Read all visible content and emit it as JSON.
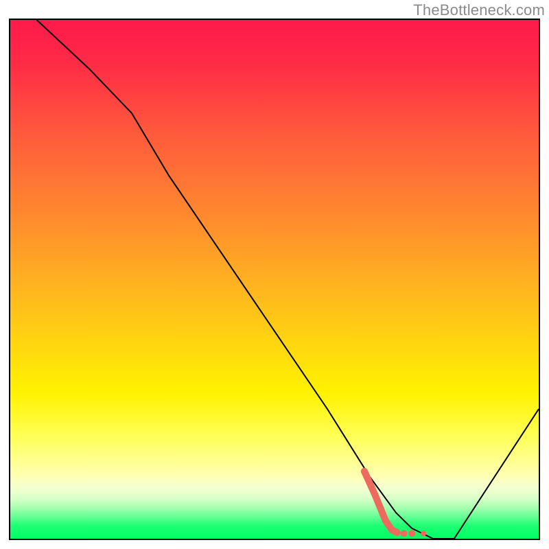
{
  "watermark": "TheBottleneck.com",
  "chart_data": {
    "type": "line",
    "title": "",
    "xlabel": "",
    "ylabel": "",
    "xlim": [
      0,
      100
    ],
    "ylim": [
      0,
      100
    ],
    "series": [
      {
        "name": "black-curve",
        "color": "#000000",
        "width": 2,
        "x": [
          5,
          15,
          23,
          30,
          40,
          50,
          60,
          68,
          73,
          76,
          80,
          84,
          100
        ],
        "y": [
          100,
          90.5,
          82,
          70,
          55,
          40,
          25,
          12,
          5,
          2,
          0,
          0,
          25
        ]
      },
      {
        "name": "salmon-marker",
        "color": "#ed6a5e",
        "width": 10,
        "x": [
          67,
          69,
          71,
          72.2,
          73.2
        ],
        "y": [
          13,
          8.5,
          3.5,
          1.7,
          1.2
        ]
      }
    ],
    "scatter": [
      {
        "name": "dot",
        "color": "#ed6a5e",
        "r": 5,
        "x": 74.5,
        "y": 1.0
      },
      {
        "name": "dot",
        "color": "#ed6a5e",
        "r": 5,
        "x": 76.0,
        "y": 1.0
      },
      {
        "name": "dot",
        "color": "#ed6a5e",
        "r": 4,
        "x": 78.2,
        "y": 1.0
      }
    ],
    "gradient_stops": [
      {
        "pct": 0,
        "color": "#fe1a4b"
      },
      {
        "pct": 8,
        "color": "#ff2a46"
      },
      {
        "pct": 22,
        "color": "#ff5a3c"
      },
      {
        "pct": 38,
        "color": "#ff8a2e"
      },
      {
        "pct": 52,
        "color": "#ffb61f"
      },
      {
        "pct": 63,
        "color": "#ffd80f"
      },
      {
        "pct": 72,
        "color": "#fff200"
      },
      {
        "pct": 80,
        "color": "#ffff55"
      },
      {
        "pct": 87.5,
        "color": "#ffffae"
      },
      {
        "pct": 90,
        "color": "#f6ffd0"
      },
      {
        "pct": 92.2,
        "color": "#d9ffc8"
      },
      {
        "pct": 94,
        "color": "#a7ffb0"
      },
      {
        "pct": 96,
        "color": "#5cff90"
      },
      {
        "pct": 97.5,
        "color": "#1eff73"
      },
      {
        "pct": 100,
        "color": "#00ff64"
      }
    ]
  }
}
